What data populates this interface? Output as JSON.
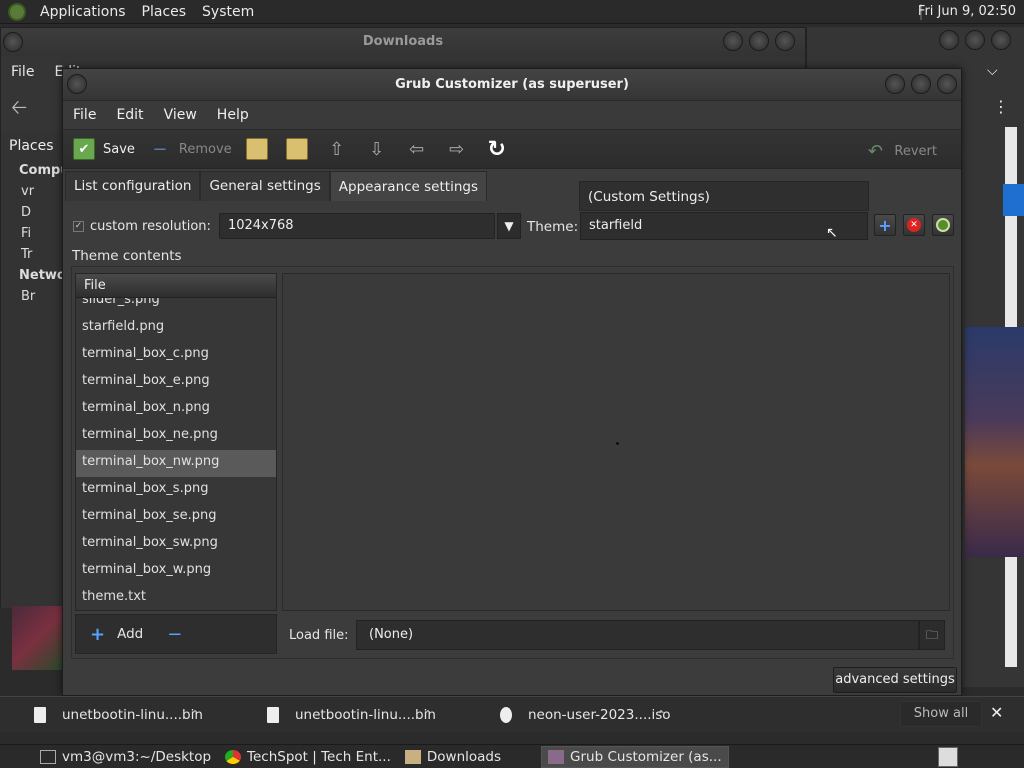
{
  "top_panel": {
    "menus": [
      "Applications",
      "Places",
      "System"
    ],
    "clock": "Fri Jun  9, 02:50"
  },
  "bg_window": {
    "title": "Downloads",
    "menu_first": "File",
    "menu_second": "Edit",
    "sidebar_header": "Places",
    "sidebar_section1": "Compu",
    "sidebar_items": [
      "vr",
      "D",
      "Fi",
      "Tr"
    ],
    "sidebar_section2": "Netwo",
    "sidebar_item_net": "Br"
  },
  "dialog": {
    "title": "Grub Customizer (as superuser)",
    "menus": [
      "File",
      "Edit",
      "View",
      "Help"
    ],
    "toolbar": {
      "save": "Save",
      "remove": "Remove",
      "revert": "Revert"
    },
    "tabs": [
      "List configuration",
      "General settings",
      "Appearance settings"
    ],
    "custom_settings": "(Custom Settings)",
    "custom_resolution_label": "custom resolution:",
    "resolution_value": "1024x768",
    "theme_label": "Theme:",
    "theme_value": "starfield",
    "theme_contents_label": "Theme contents",
    "file_list": {
      "header": "File",
      "items": [
        "slider_s.png",
        "starfield.png",
        "terminal_box_c.png",
        "terminal_box_e.png",
        "terminal_box_n.png",
        "terminal_box_ne.png",
        "terminal_box_nw.png",
        "terminal_box_s.png",
        "terminal_box_se.png",
        "terminal_box_sw.png",
        "terminal_box_w.png",
        "theme.txt"
      ],
      "selected": "terminal_box_nw.png"
    },
    "add_label": "Add",
    "load_file_label": "Load file:",
    "load_file_value": "(None)",
    "advanced_settings": "advanced settings"
  },
  "downloads_shelf": {
    "items": [
      "unetbootin-linu....bin",
      "unetbootin-linu....bin",
      "neon-user-2023....iso"
    ],
    "show_all": "Show all"
  },
  "taskbar": {
    "items": [
      "vm3@vm3:~/Desktop",
      "TechSpot | Tech Ent...",
      "Downloads",
      "Grub Customizer (as..."
    ]
  }
}
